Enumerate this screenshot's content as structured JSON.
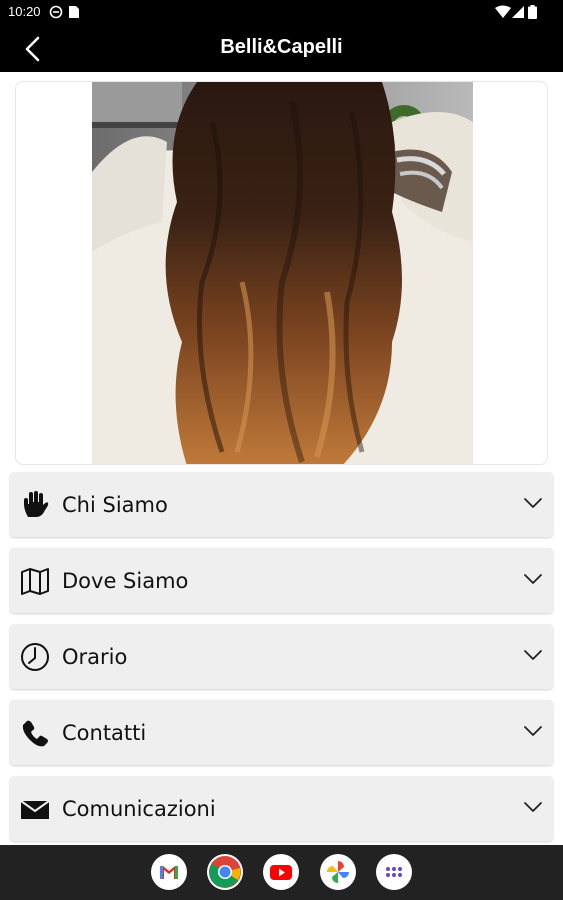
{
  "status_bar": {
    "time": "10:20"
  },
  "app_bar": {
    "title": "Belli&Capelli"
  },
  "sections": [
    {
      "label": "Chi Siamo",
      "icon": "hand-icon"
    },
    {
      "label": "Dove Siamo",
      "icon": "map-icon"
    },
    {
      "label": "Orario",
      "icon": "clock-icon"
    },
    {
      "label": "Contatti",
      "icon": "phone-icon"
    },
    {
      "label": "Comunicazioni",
      "icon": "envelope-icon"
    }
  ],
  "dock": [
    "gmail-icon",
    "chrome-icon",
    "youtube-icon",
    "photos-icon",
    "app-drawer-icon"
  ]
}
